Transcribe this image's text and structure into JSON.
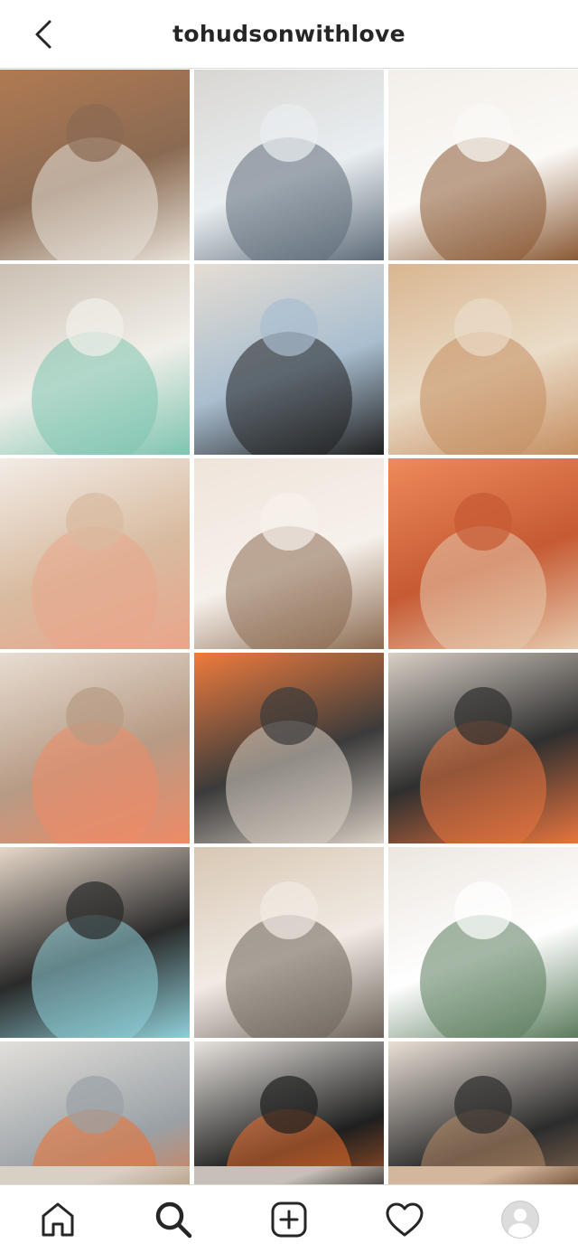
{
  "header": {
    "title": "tohudsonwithlove",
    "back_icon": "chevron-left-icon"
  },
  "grid": {
    "posts": [
      {
        "name": "post-puppy-and-toddler",
        "colors": [
          "#b07a52",
          "#e8e2d8",
          "#8a6a52"
        ]
      },
      {
        "name": "post-toddler-in-vest",
        "colors": [
          "#d9d6d2",
          "#5e6b78",
          "#e9eef1"
        ]
      },
      {
        "name": "post-woman-holding-puppy",
        "colors": [
          "#f3eee8",
          "#8a5a35",
          "#fbfaf7"
        ]
      },
      {
        "name": "post-two-kids-with-ukulele",
        "colors": [
          "#cbbfb2",
          "#7ec4b0",
          "#f1efe9"
        ]
      },
      {
        "name": "post-woman-black-top",
        "colors": [
          "#e5ddd2",
          "#1f1f1f",
          "#a9bed0"
        ]
      },
      {
        "name": "post-boy-on-playset",
        "colors": [
          "#d9b690",
          "#c58e61",
          "#eadcc8"
        ]
      },
      {
        "name": "post-skincare-products",
        "colors": [
          "#f2ece6",
          "#e9a58a",
          "#d8bba0"
        ]
      },
      {
        "name": "post-woman-with-mug",
        "colors": [
          "#efe4da",
          "#8a6a50",
          "#f7f1ec"
        ]
      },
      {
        "name": "post-mom-and-baby-orange",
        "colors": [
          "#ee8a5b",
          "#e6c9ad",
          "#c65a33"
        ]
      },
      {
        "name": "post-woman-candy-bar",
        "colors": [
          "#e8ddd2",
          "#ee8a66",
          "#b79b85"
        ]
      },
      {
        "name": "post-kid-orange-hard-hat",
        "colors": [
          "#ef7b3c",
          "#d9cfc4",
          "#3b3b3b"
        ]
      },
      {
        "name": "post-siblings-on-stairs",
        "colors": [
          "#d8cfc5",
          "#e7743f",
          "#2f2f2f"
        ]
      },
      {
        "name": "post-two-women-selfie",
        "colors": [
          "#e7d8c9",
          "#8fcfd8",
          "#2a2a2a"
        ]
      },
      {
        "name": "post-boy-with-toy-sword",
        "colors": [
          "#d8c7b3",
          "#6c6259",
          "#f1ebe4"
        ]
      },
      {
        "name": "post-woman-with-coffee",
        "colors": [
          "#ece6df",
          "#5a7b5c",
          "#ffffff"
        ]
      },
      {
        "name": "post-kid-on-frozen-lake",
        "colors": [
          "#e2dfda",
          "#ee6f2e",
          "#9aa1a6"
        ]
      },
      {
        "name": "post-woman-orange-puffer",
        "colors": [
          "#e7e3de",
          "#e86e2b",
          "#1f1f1f"
        ]
      },
      {
        "name": "post-mom-and-son-cuddle",
        "colors": [
          "#e9dfd5",
          "#b58a66",
          "#2c2c2c"
        ]
      }
    ],
    "partial_row": [
      {
        "name": "post-partial-1",
        "colors": [
          "#d8cfc5",
          "#bda78f"
        ]
      },
      {
        "name": "post-partial-2",
        "colors": [
          "#c7c0ba",
          "#4f4a46"
        ]
      },
      {
        "name": "post-partial-3",
        "colors": [
          "#d3b79d",
          "#7c5b40"
        ]
      }
    ]
  },
  "bottom_nav": {
    "items": [
      {
        "name": "nav-home",
        "icon": "home-icon"
      },
      {
        "name": "nav-search",
        "icon": "search-icon",
        "active": true
      },
      {
        "name": "nav-create",
        "icon": "plus-square-icon"
      },
      {
        "name": "nav-activity",
        "icon": "heart-icon"
      },
      {
        "name": "nav-profile",
        "icon": "avatar-icon"
      }
    ]
  }
}
